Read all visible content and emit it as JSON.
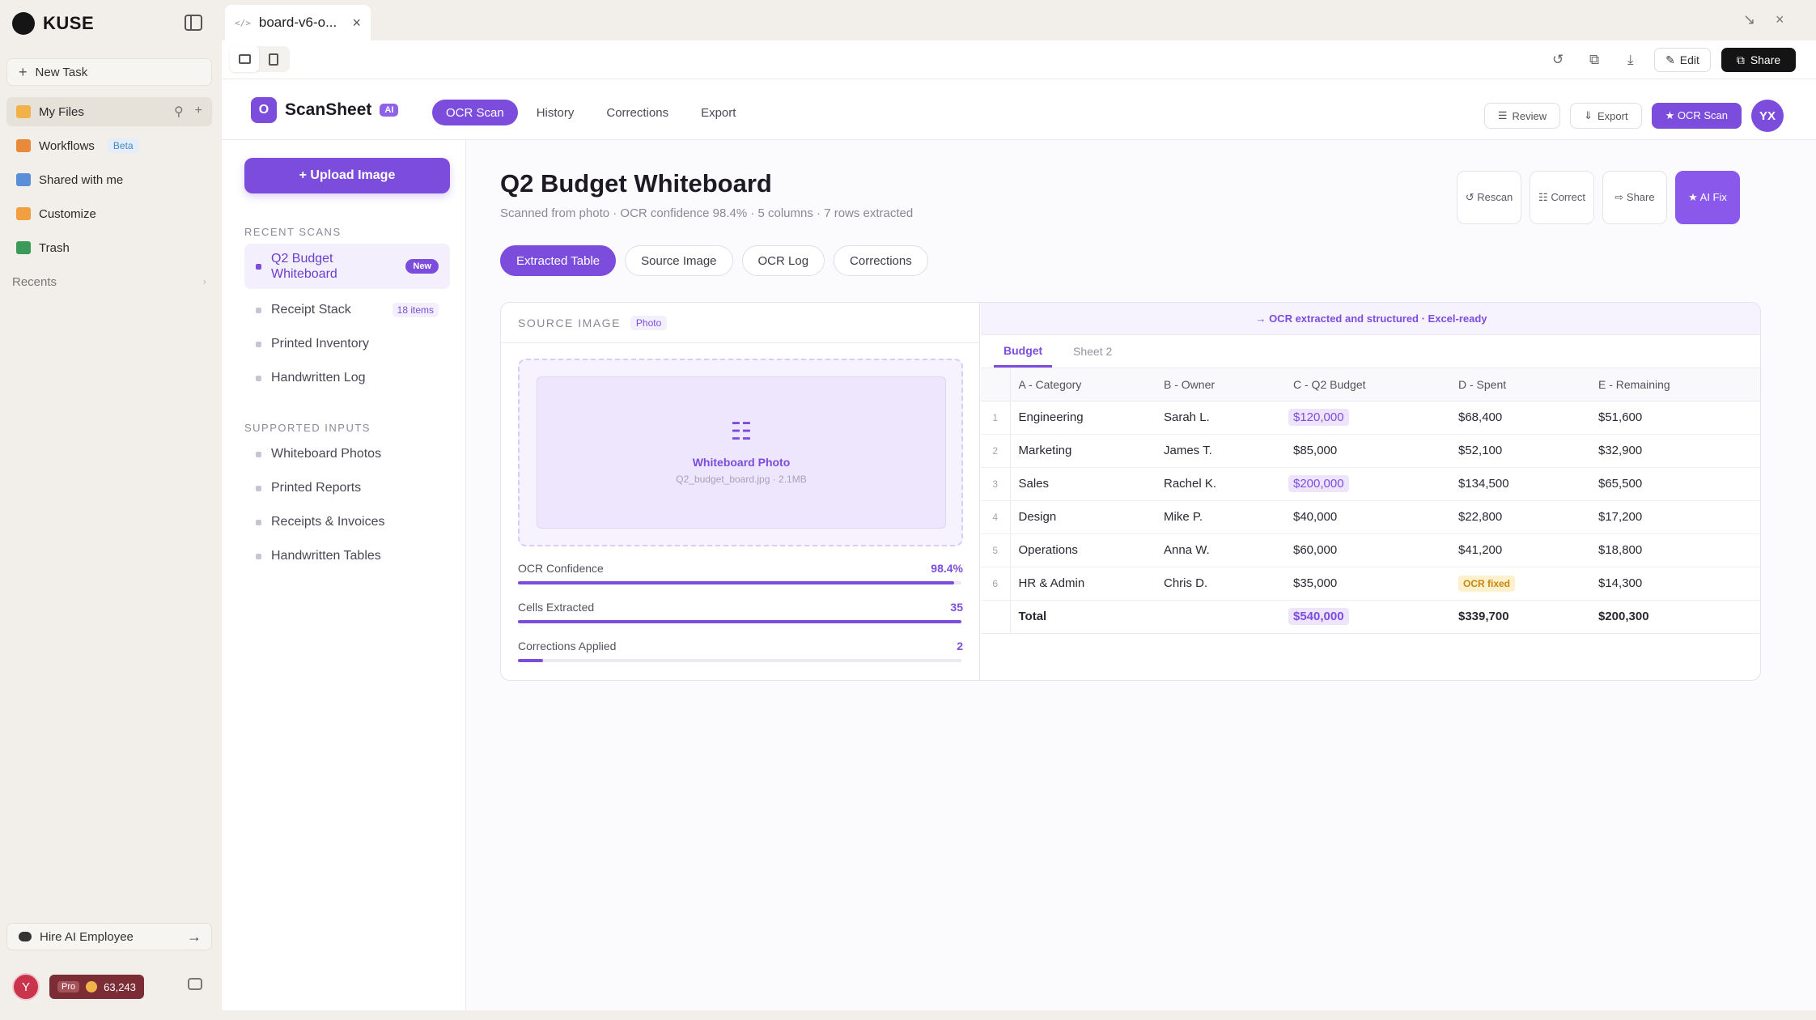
{
  "kuse": {
    "logo_text": "KUSE",
    "new_task": "New Task",
    "nav": [
      {
        "label": "My Files",
        "icon": "folder-icon",
        "color": "#f2b24a"
      },
      {
        "label": "Workflows",
        "icon": "workflow-icon",
        "color": "#e88a3a",
        "badge": "Beta"
      },
      {
        "label": "Shared with me",
        "icon": "shared-folder-icon",
        "color": "#5a8fd8"
      },
      {
        "label": "Customize",
        "icon": "puzzle-icon",
        "color": "#f0a040"
      },
      {
        "label": "Trash",
        "icon": "trash-icon",
        "color": "#3a9a5a"
      }
    ],
    "recents_label": "Recents",
    "hire_label": "Hire AI Employee",
    "user_initial": "Y",
    "plan": "Pro",
    "credits": "63,243"
  },
  "window": {
    "tab_title": "board-v6-o...",
    "edit_label": "Edit",
    "share_label": "Share"
  },
  "app": {
    "brand_initial": "O",
    "brand_name": "ScanSheet",
    "brand_badge": "AI",
    "nav": [
      "OCR Scan",
      "History",
      "Corrections",
      "Export"
    ],
    "active_nav": "OCR Scan",
    "header_actions": {
      "review": "Review",
      "export": "Export",
      "ocr_scan": "★ OCR Scan"
    },
    "user_initials": "YX",
    "accent_color": "#7c4ddd"
  },
  "sidebar": {
    "upload_label": "+ Upload Image",
    "recent_heading": "RECENT SCANS",
    "recent": [
      {
        "label": "Q2 Budget Whiteboard",
        "badge": "New"
      },
      {
        "label": "Receipt Stack",
        "badge": "18 items"
      },
      {
        "label": "Printed Inventory"
      },
      {
        "label": "Handwritten Log"
      }
    ],
    "supported_heading": "SUPPORTED INPUTS",
    "supported": [
      "Whiteboard Photos",
      "Printed Reports",
      "Receipts & Invoices",
      "Handwritten Tables"
    ]
  },
  "document": {
    "title": "Q2 Budget Whiteboard",
    "subtitle": "Scanned from photo · OCR confidence 98.4% · 5 columns · 7 rows extracted",
    "actions": {
      "rescan": "↺ Rescan",
      "correct": "☷ Correct",
      "share": "⇨ Share",
      "ai_fix": "★ AI Fix"
    },
    "tabs": [
      "Extracted Table",
      "Source Image",
      "OCR Log",
      "Corrections"
    ],
    "active_tab": "Extracted Table"
  },
  "source": {
    "heading": "SOURCE IMAGE",
    "tag": "Photo",
    "image_label": "Whiteboard Photo",
    "image_file": "Q2_budget_board.jpg · 2.1MB",
    "metrics": [
      {
        "label": "OCR Confidence",
        "value": "98.4%",
        "fill": 0.984
      },
      {
        "label": "Cells Extracted",
        "value": "35",
        "fill": 1.0
      },
      {
        "label": "Corrections Applied",
        "value": "2",
        "fill": 0.057
      }
    ]
  },
  "table": {
    "notice": "→ OCR extracted and structured · Excel-ready",
    "sheets": [
      "Budget",
      "Sheet 2"
    ],
    "active_sheet": "Budget",
    "columns": [
      "A - Category",
      "B - Owner",
      "C - Q2 Budget",
      "D - Spent",
      "E - Remaining"
    ],
    "rows": [
      {
        "n": "1",
        "category": "Engineering",
        "owner": "Sarah L.",
        "budget": "$120,000",
        "spent": "$68,400",
        "remaining": "$51,600"
      },
      {
        "n": "2",
        "category": "Marketing",
        "owner": "James T.",
        "budget": "$85,000",
        "spent": "$52,100",
        "remaining": "$32,900"
      },
      {
        "n": "3",
        "category": "Sales",
        "owner": "Rachel K.",
        "budget": "$200,000",
        "spent": "$134,500",
        "remaining": "$65,500"
      },
      {
        "n": "4",
        "category": "Design",
        "owner": "Mike P.",
        "budget": "$40,000",
        "spent": "$22,800",
        "remaining": "$17,200"
      },
      {
        "n": "5",
        "category": "Operations",
        "owner": "Anna W.",
        "budget": "$60,000",
        "spent": "$41,200",
        "remaining": "$18,800"
      },
      {
        "n": "6",
        "category": "HR & Admin",
        "owner": "Chris D.",
        "budget": "$35,000",
        "spent": "OCR fixed",
        "remaining": "$14,300"
      }
    ],
    "total": {
      "label": "Total",
      "budget": "$540,000",
      "spent": "$339,700",
      "remaining": "$200,300"
    }
  }
}
